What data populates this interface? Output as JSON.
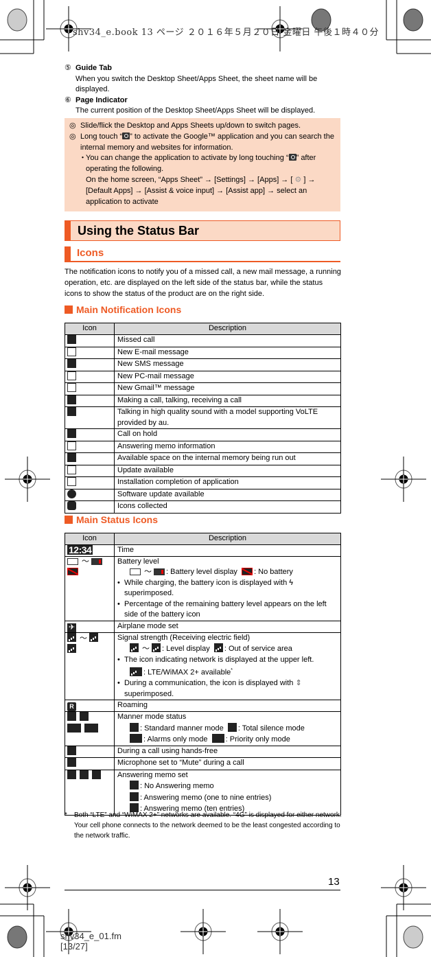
{
  "print_header": "shv34_e.book   13 ページ   ２０１６年５月２０日   金曜日   午後１時４０分",
  "guide": [
    {
      "num": "⑤",
      "title": "Guide Tab",
      "desc": "When you switch the Desktop Sheet/Apps Sheet, the sheet name will be displayed."
    },
    {
      "num": "⑥",
      "title": "Page Indicator",
      "desc": "The current position of the Desktop Sheet/Apps Sheet will be displayed."
    }
  ],
  "note": {
    "marker": "◎",
    "line1": "Slide/flick the Desktop and Apps Sheets up/down to switch pages.",
    "line2_pre": "Long touch “",
    "line2_post": "” to activate the Google™ application and you can search the internal memory and websites for information.",
    "sub_marker": "・",
    "sub_pre": "You can change the application to activate by long touching “",
    "sub_post": "” after operating the following.",
    "path_pre": "On the home screen, “Apps Sheet” → [Settings] → [Apps] → [",
    "gear": "⚙",
    "path_post": "] → [Default Apps] → [Assist & voice input] → [Assist app] → select an application to activate"
  },
  "section_title": "Using the Status Bar",
  "subsection_title": "Icons",
  "intro": "The notification icons to notify you of a missed call, a new mail message, a running operation, etc. are displayed on the left side of the status bar, while the status icons to show the status of the product are on the right side.",
  "notif": {
    "heading": "Main Notification Icons",
    "col_icon": "Icon",
    "col_desc": "Description",
    "rows": [
      {
        "icon": "missed-call",
        "desc": "Missed call"
      },
      {
        "icon": "email",
        "desc": "New E-mail message"
      },
      {
        "icon": "sms",
        "desc": "New SMS message"
      },
      {
        "icon": "pc-mail",
        "desc": "New PC-mail message"
      },
      {
        "icon": "gmail",
        "desc": "New Gmail™ message"
      },
      {
        "icon": "call",
        "desc": "Making a call, talking, receiving a call"
      },
      {
        "icon": "hd-call",
        "desc": "Talking in high quality sound with a model supporting VoLTE provided by au."
      },
      {
        "icon": "call-hold",
        "desc": "Call on hold"
      },
      {
        "icon": "answering-memo",
        "desc": "Answering memo information"
      },
      {
        "icon": "memory-low",
        "desc": "Available space on the internal memory being run out"
      },
      {
        "icon": "update",
        "desc": "Update available"
      },
      {
        "icon": "install-complete",
        "desc": "Installation completion of application"
      },
      {
        "icon": "software-update",
        "desc": "Software update available"
      },
      {
        "icon": "icons-collected",
        "desc": "Icons collected"
      }
    ]
  },
  "status": {
    "heading": "Main Status Icons",
    "col_icon": "Icon",
    "col_desc": "Description",
    "time": {
      "icon_text": "12:34",
      "desc": "Time"
    },
    "battery": {
      "title": "Battery level",
      "display_label": ": Battery level display",
      "no_battery_label": ": No battery",
      "bullet1_pre": "While charging, the battery icon is displayed with",
      "bullet1_post": "superimposed.",
      "bolt": "ϟ",
      "bullet2": "Percentage of the remaining battery level appears on the left side of the battery icon"
    },
    "airplane": {
      "icon": "✈",
      "desc": "Airplane mode set"
    },
    "signal": {
      "title": "Signal strength (Receiving electric field)",
      "level_label": ": Level display",
      "out_label": ": Out of service area",
      "bullet1": "The icon indicating network is displayed at the upper left.",
      "lte_label": ": LTE/WiMAX 2+ available",
      "lte_mark": "*",
      "bullet2_pre": "During a communication, the icon is displayed with",
      "updown": "⇕",
      "bullet2_post": "superimposed."
    },
    "roaming": {
      "icon": "R",
      "desc": "Roaming"
    },
    "manner": {
      "title": "Manner mode status",
      "standard": ": Standard manner mode",
      "silence": ": Total silence mode",
      "alarms": ": Alarms only mode",
      "priority": ": Priority only mode"
    },
    "handsfree": {
      "desc": "During a call using hands-free"
    },
    "mute": {
      "desc": "Microphone set to “Mute” during a call"
    },
    "memo": {
      "title": "Answering memo set",
      "none": ": No Answering memo",
      "some": ": Answering memo (one to nine entries)",
      "ten": ": Answering memo (ten entries)"
    },
    "tilde": "〜"
  },
  "footnote": {
    "mark": "*",
    "text": "Both “LTE” and “WiMAX 2+” networks are available. “4G” is displayed for either network. Your cell phone connects to the network deemed to be the least congested according to the network traffic."
  },
  "page_number": "13",
  "print_footer_line1": "shv34_e_01.fm",
  "print_footer_line2": "[13/27]",
  "colors": {
    "accent": "#ee5a24",
    "note_bg": "#fbd9c5",
    "header_bg": "#d9d9d9"
  }
}
